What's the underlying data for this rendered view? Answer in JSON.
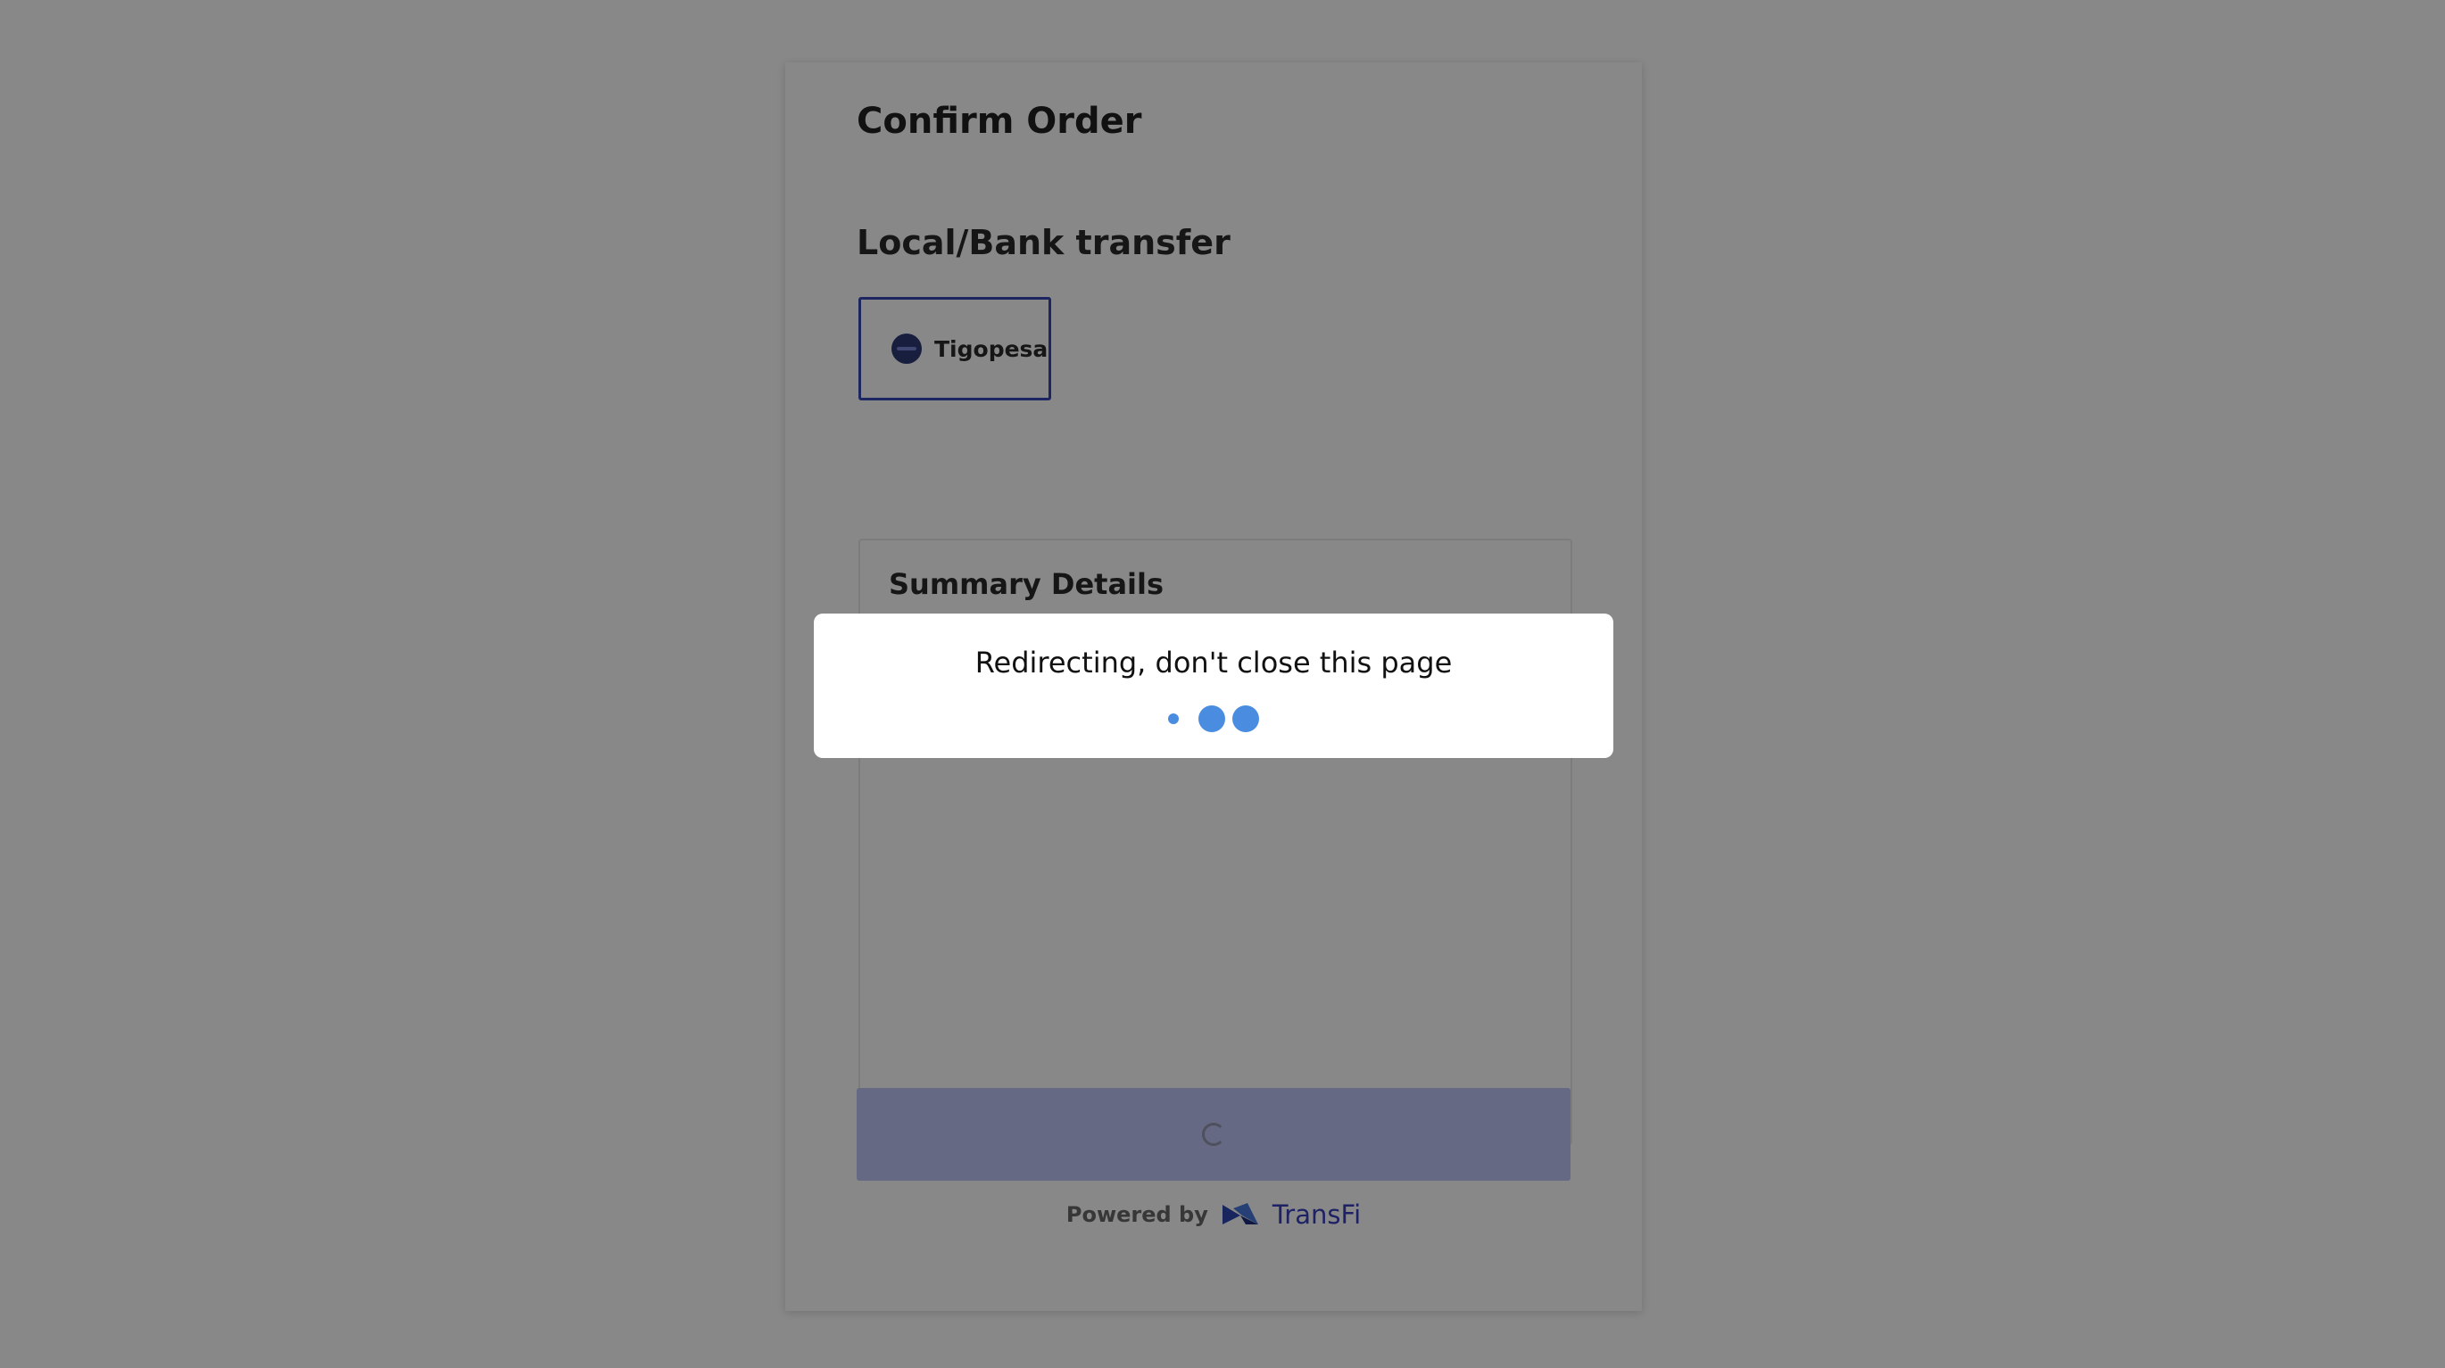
{
  "page": {
    "title": "Confirm Order",
    "section_label": "Local/Bank transfer"
  },
  "payment_methods": [
    {
      "label": "Tigopesa",
      "selected": true,
      "icon": "tigopesa-logo"
    }
  ],
  "summary": {
    "title": "Summary Details"
  },
  "confirm_button": {
    "state": "loading",
    "icon": "loading-spinner-icon"
  },
  "footer": {
    "powered_by": "Powered by",
    "brand": "TransFi",
    "brand_icon": "transfi-logo-icon"
  },
  "modal": {
    "message": "Redirecting, don't close this page",
    "icon": "loading-dots-icon"
  },
  "colors": {
    "accent": "#2a3bb0",
    "button_disabled": "#b8c1f5",
    "brand": "#2a33b8",
    "loader": "#4a8de0"
  }
}
